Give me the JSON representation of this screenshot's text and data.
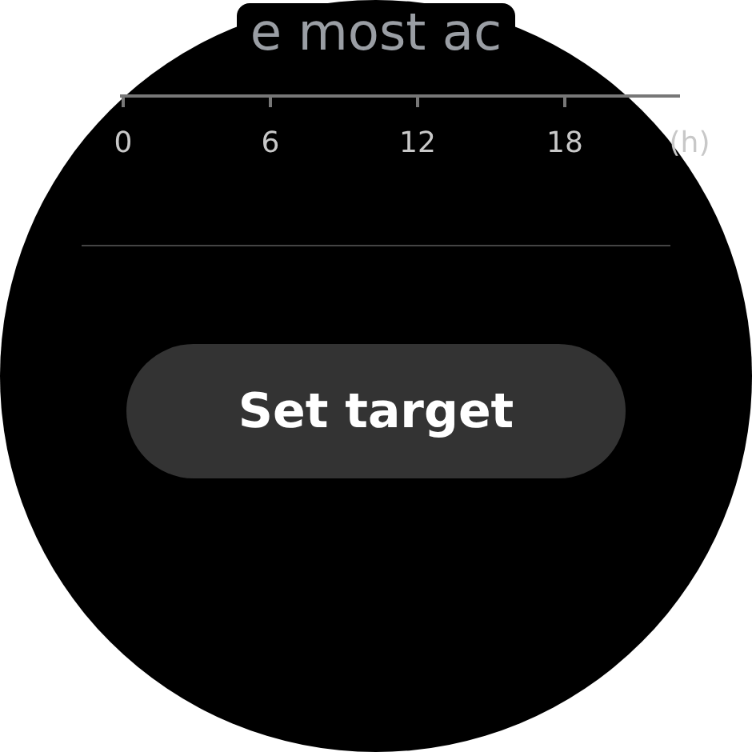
{
  "heading": "e most ac",
  "axis": {
    "ticks": [
      "0",
      "6",
      "12",
      "18"
    ],
    "unit": "(h)"
  },
  "button": {
    "label": "Set target"
  }
}
